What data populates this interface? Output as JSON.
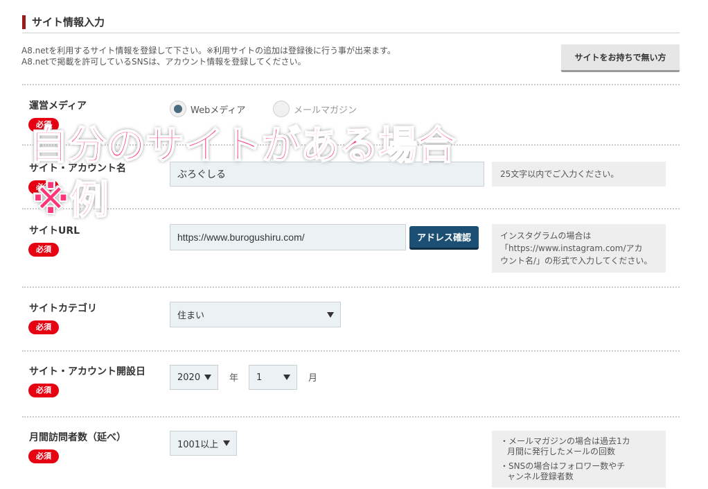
{
  "section": {
    "title": "サイト情報入力"
  },
  "intro": {
    "line1": "A8.netを利用するサイト情報を登録して下さい。※利用サイトの追加は登録後に行う事が出来ます。",
    "line2": "A8.netで掲載を許可しているSNSは、アカウント情報を登録してください。"
  },
  "no_site_button": "サイトをお持ちで無い方",
  "required_label": "必須",
  "media": {
    "label": "運営メディア",
    "options": [
      "Webメディア",
      "メールマガジン"
    ],
    "selected": "Webメディア"
  },
  "site_name": {
    "label": "サイト・アカウント名",
    "value": "ぶろぐしる",
    "hint": "25文字以内でご入力ください。"
  },
  "site_url": {
    "label": "サイトURL",
    "value": "https://www.burogushiru.com/",
    "button": "アドレス確認",
    "hint_lines": [
      "インスタグラムの場合は",
      "「https://www.instagram.com/アカ",
      "ウント名/」の形式で入力してください。"
    ]
  },
  "category": {
    "label": "サイトカテゴリ",
    "value": "住まい"
  },
  "open_date": {
    "label": "サイト・アカウント開設日",
    "year": "2020",
    "year_unit": "年",
    "month": "1",
    "month_unit": "月"
  },
  "visitors": {
    "label": "月間訪問者数（延べ）",
    "value": "1001以上",
    "hint_lines": [
      "・メールマガジンの場合は過去1カ",
      "月間に発行したメールの回数",
      "・SNSの場合はフォロワー数やチ",
      "ャンネル登録者数"
    ]
  },
  "overlay": {
    "line1": "自分のサイトがある場合",
    "line2": "※例"
  }
}
